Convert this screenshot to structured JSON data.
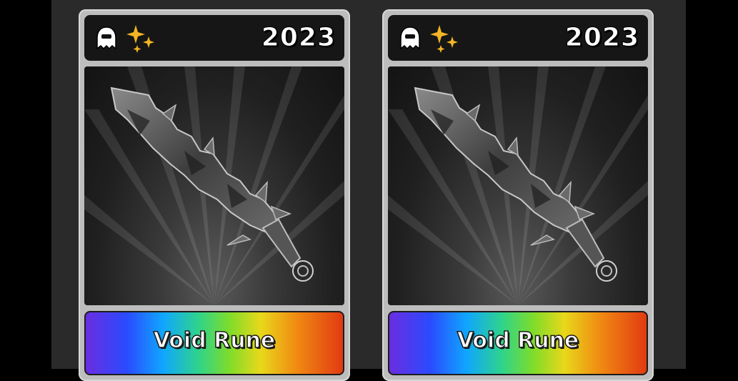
{
  "cards": [
    {
      "year": "2023",
      "item_name": "Void Rune",
      "badges": [
        "ghost-icon",
        "sparkle-icon"
      ]
    },
    {
      "year": "2023",
      "item_name": "Void Rune",
      "badges": [
        "ghost-icon",
        "sparkle-icon"
      ]
    }
  ],
  "colors": {
    "panel": "#2a2a2a",
    "card_frame": "#bdbdbd",
    "header": "#161616",
    "sparkle": "#f2b524",
    "rainbow": [
      "#6a2de0",
      "#2a4bff",
      "#10a6ff",
      "#2fd48a",
      "#7fdc2a",
      "#e8d81a",
      "#f08a12",
      "#e23a12"
    ]
  }
}
